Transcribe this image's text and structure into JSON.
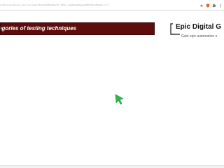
{
  "browser": {
    "url": "nifarnessinterne.com/s/2/3/a8/1f2e5ab5796b8dc5c-f8b1c-aa8gfa3ddaage6f8f2a3c8fb9a9c-ce-bab44886-2_3/2",
    "extension_icons": [
      "star-icon",
      "shield-icon",
      "puzzle-icon",
      "menu-icon"
    ]
  },
  "slide": {
    "title": "egories of testing techniques",
    "brand_title": "Epic Digital G",
    "brand_subtitle": "Gain epic automation s"
  },
  "cursor": {
    "icon": "pointer-cursor-icon",
    "color": "#2db84b"
  },
  "colors": {
    "title_bar": "#5e0d0d",
    "title_text": "#ffffff",
    "brand_text": "#111111"
  }
}
